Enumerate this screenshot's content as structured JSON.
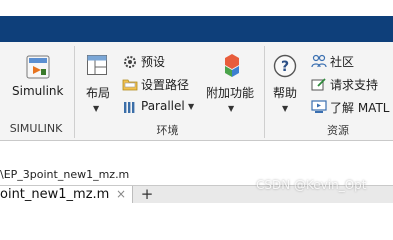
{
  "ribbon": {
    "simulink": {
      "button_label": "Simulink",
      "group_label": "SIMULINK"
    },
    "environment": {
      "layout_label": "布局",
      "preferences_label": "预设",
      "set_path_label": "设置路径",
      "parallel_label": "Parallel",
      "addons_label": "附加功能",
      "group_label": "环境"
    },
    "resources": {
      "help_label": "帮助",
      "community_label": "社区",
      "request_support_label": "请求支持",
      "learn_matlab_label": "了解 MATL",
      "group_label": "资源"
    }
  },
  "path_bar": {
    "text": "\\EP_3point_new1_mz.m"
  },
  "editor_tabs": {
    "active_tab_label": "oint_new1_mz.m",
    "close_symbol": "×",
    "add_tab_symbol": "+"
  },
  "watermark": {
    "text": "CSDN @Kevin_Opt"
  },
  "colors": {
    "title_bar": "#0e3f7a",
    "ribbon_bg": "#f4f4f4"
  }
}
